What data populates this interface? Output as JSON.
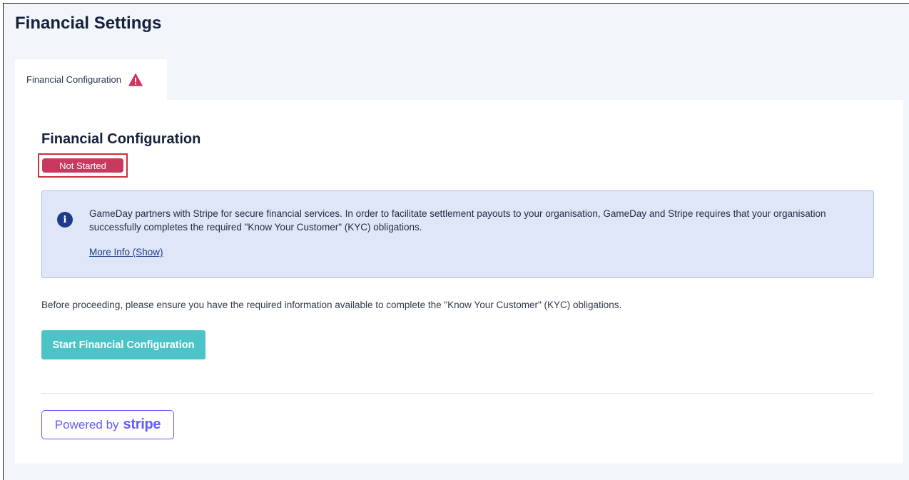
{
  "page": {
    "title": "Financial Settings"
  },
  "tabs": [
    {
      "label": "Financial Configuration",
      "icon": "warning-icon",
      "icon_color": "#c9385e"
    }
  ],
  "section": {
    "title": "Financial Configuration",
    "status": "Not Started",
    "status_color": "#c9385e"
  },
  "info": {
    "icon": "info-icon",
    "text": "GameDay partners with Stripe for secure financial services. In order to facilitate settlement payouts to your organisation, GameDay and Stripe requires that your organisation successfully completes the required \"Know Your Customer\" (KYC) obligations.",
    "link": "More Info (Show)"
  },
  "note": "Before proceeding, please ensure you have the required information available to complete the \"Know Your Customer\" (KYC) obligations.",
  "button": {
    "label": "Start Financial Configuration",
    "color": "#4cc3c6"
  },
  "powered_by": {
    "prefix": "Powered by",
    "brand": "stripe",
    "color": "#635bff"
  }
}
